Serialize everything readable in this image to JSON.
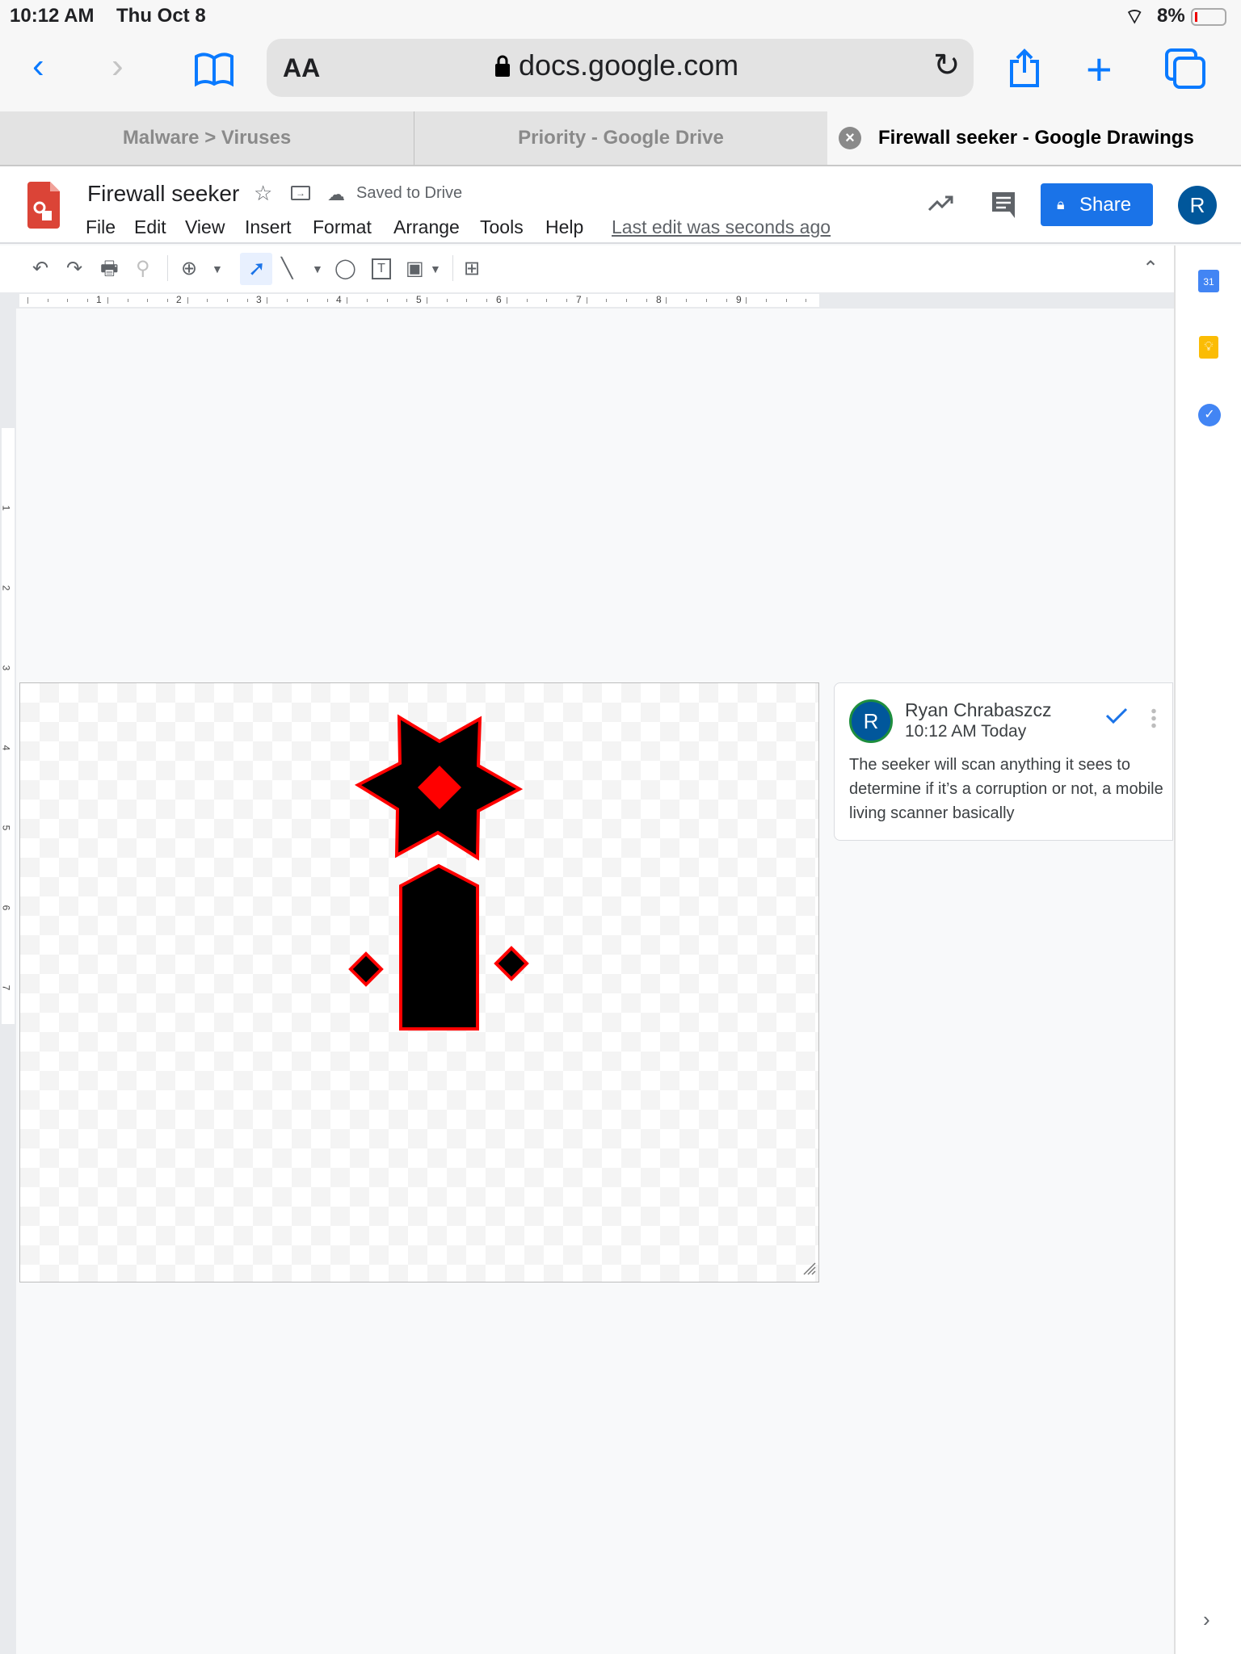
{
  "status_bar": {
    "time": "10:12 AM",
    "date": "Thu Oct 8",
    "battery": "8%"
  },
  "browser": {
    "text_size_label": "AA",
    "url": "docs.google.com",
    "tabs": [
      {
        "label": "Malware > Viruses"
      },
      {
        "label": "Priority - Google Drive"
      },
      {
        "label": "Firewall seeker - Google Drawings",
        "active": true
      }
    ]
  },
  "doc": {
    "title": "Firewall seeker",
    "save_status": "Saved to Drive",
    "menu": [
      "File",
      "Edit",
      "View",
      "Insert",
      "Format",
      "Arrange",
      "Tools",
      "Help"
    ],
    "last_edit": "Last edit was seconds ago",
    "share_label": "Share",
    "avatar_letter": "R"
  },
  "ruler": {
    "h_ticks": [
      "1",
      "2",
      "3",
      "4",
      "5",
      "6",
      "7",
      "8",
      "9"
    ],
    "v_ticks": [
      "1",
      "2",
      "3",
      "4",
      "5",
      "6",
      "7"
    ]
  },
  "side_panel": {
    "calendar_day": "31"
  },
  "comment": {
    "author": "Ryan Chrabaszcz",
    "time": "10:12 AM Today",
    "avatar_letter": "R",
    "text": "The seeker will scan anything it sees to determine if it’s a corruption or not, a mobile living scanner basically"
  },
  "colors": {
    "accent": "#1a73e8",
    "shape_fill": "#000000",
    "shape_stroke": "#ff0000",
    "avatar": "#01579b"
  }
}
